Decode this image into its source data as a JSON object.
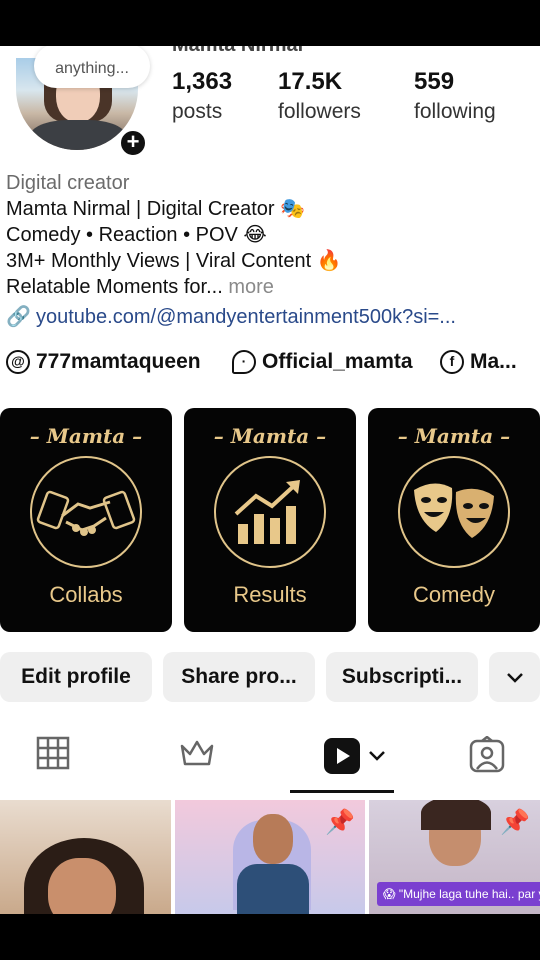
{
  "profile": {
    "name_partial": "Mamta Nirmal",
    "note_text": "anything...",
    "avatar_icon": "person-photo",
    "add_icon": "plus-icon"
  },
  "stats": [
    {
      "value": "1,363",
      "label": "posts"
    },
    {
      "value": "17.5K",
      "label": "followers"
    },
    {
      "value": "559",
      "label": "following"
    }
  ],
  "bio": {
    "category": "Digital creator",
    "lines": [
      "Mamta Nirmal | Digital Creator 🎭",
      "Comedy • Reaction • POV 😂",
      "3M+ Monthly Views | Viral Content 🔥"
    ],
    "last_line": "Relatable Moments for...",
    "more": " more",
    "link": "youtube.com/@mandyentertainment500k?si=..."
  },
  "social": [
    {
      "icon": "threads-icon",
      "label": "777mamtaqueen"
    },
    {
      "icon": "chat-icon",
      "label": "Official_mamta"
    },
    {
      "icon": "facebook-icon",
      "label": "Ma..."
    }
  ],
  "highlights": [
    {
      "title": "– Mamta –",
      "label": "Collabs",
      "icon": "handshake-icon"
    },
    {
      "title": "– Mamta –",
      "label": "Results",
      "icon": "growth-chart-icon"
    },
    {
      "title": "– Mamta –",
      "label": "Comedy",
      "icon": "theater-masks-icon"
    }
  ],
  "buttons": {
    "edit": "Edit profile",
    "share": "Share pro...",
    "subscriptions": "Subscripti...",
    "more_icon": "chevron-down-icon"
  },
  "tabs": [
    {
      "icon": "grid-icon"
    },
    {
      "icon": "crown-icon"
    },
    {
      "icon": "reels-icon",
      "active": true
    },
    {
      "icon": "tagged-icon"
    }
  ],
  "thumbnails": {
    "caption": "😱 \"Mujhe laga tuhe hai.. par ye sach nikla!"
  },
  "colors": {
    "accent_gold": "#e8c88a",
    "link_blue": "#2a4a8a",
    "caption_purple": "#7a3fd0"
  }
}
